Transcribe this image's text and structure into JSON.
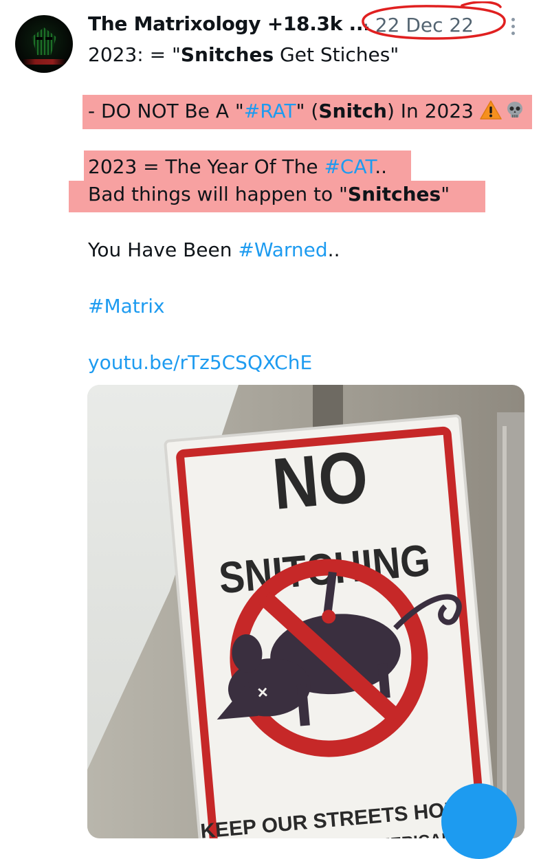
{
  "tweet": {
    "author": "The Matrixology +18.3k ...",
    "date": "· 22 Dec 22",
    "line1_prefix": "2023: = \"",
    "line1_bold": "Snitches",
    "line1_suffix": " Get Stiches\"",
    "line2_part1": "- DO NOT Be A \"",
    "line2_tag": "#RAT",
    "line2_part2": "\" (",
    "line2_bold": "Snitch",
    "line2_part3": ") In 2023 ",
    "line3_part1": "2023 = The Year Of The ",
    "line3_tag": "#CAT",
    "line3_part2": "..",
    "line4_part1": "Bad things will happen to \"",
    "line4_bold": "Snitches",
    "line4_part2": "\"",
    "line5_part1": "You Have Been ",
    "line5_tag": "#Warned",
    "line5_part2": "..",
    "hashtag": "#Matrix",
    "link": "youtu.be/rTz5CSQXChE",
    "emojis": [
      "warning-icon",
      "skull-icon"
    ]
  },
  "photo": {
    "sign_text": [
      "NO",
      "SNITCHING",
      "KEEP OUR STREETS HONEST",
      "...ANCE IS UN-AMERICAN"
    ],
    "sign_colors": {
      "border": "#c62828",
      "text": "#2a2a2a",
      "rat": "#3a2f3f"
    }
  },
  "colors": {
    "highlight": "#f7a1a1",
    "link": "#1d9bf0",
    "date_circle": "#e02020",
    "muted": "#536471"
  }
}
